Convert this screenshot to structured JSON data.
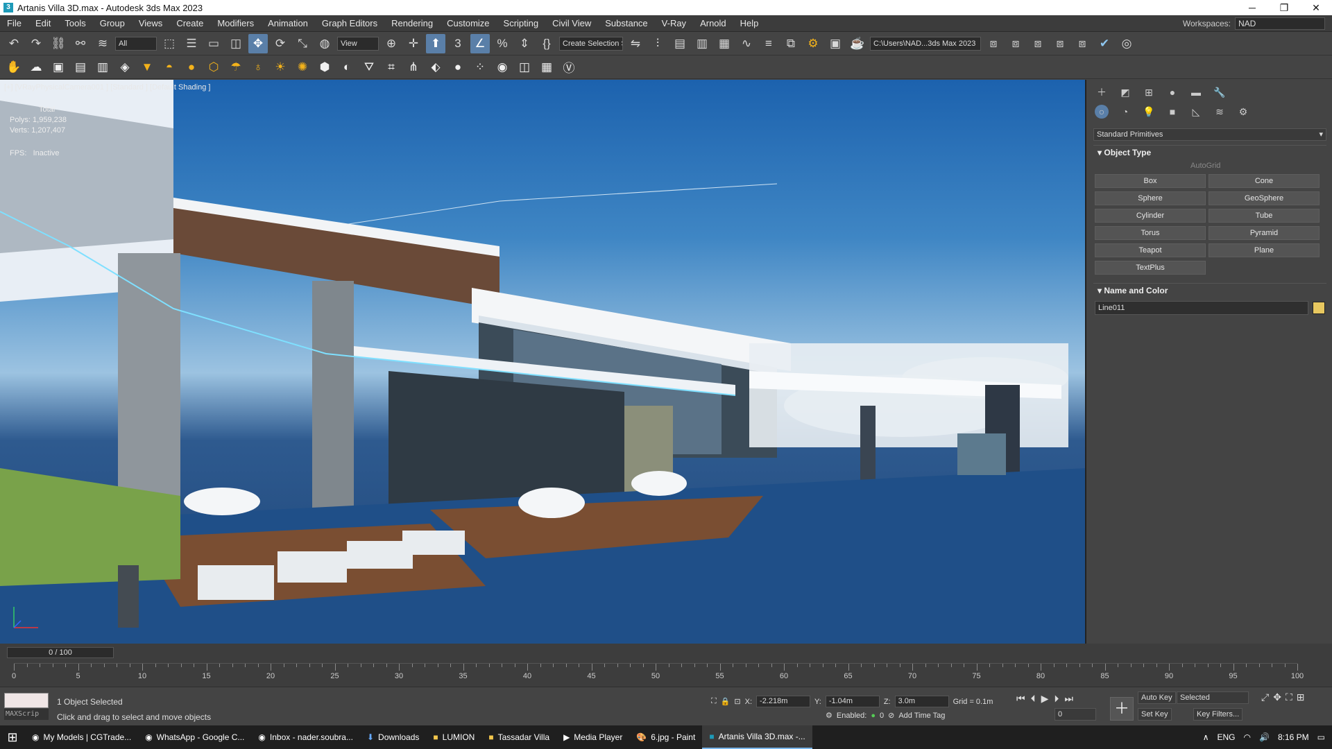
{
  "window": {
    "title": "Artanis Villa 3D.max - Autodesk 3ds Max 2023"
  },
  "menu": [
    "File",
    "Edit",
    "Tools",
    "Group",
    "Views",
    "Create",
    "Modifiers",
    "Animation",
    "Graph Editors",
    "Rendering",
    "Customize",
    "Scripting",
    "Civil View",
    "Substance",
    "V-Ray",
    "Arnold",
    "Help"
  ],
  "workspace": {
    "label": "Workspaces:",
    "value": "NAD"
  },
  "toolbar": {
    "filter": "All",
    "ref_coord": "View",
    "selection_set": "Create Selection Se",
    "project_path": "C:\\Users\\NAD...3ds Max 2023"
  },
  "viewport": {
    "label": "[+] [VRayPhysicalCamera001 ] [Standard ] [Default Shading ]",
    "stats_header": "Total",
    "polys_label": "Polys:",
    "polys": "1,959,238",
    "verts_label": "Verts:",
    "verts": "1,207,407",
    "fps_label": "FPS:",
    "fps": "Inactive"
  },
  "command_panel": {
    "category": "Standard Primitives",
    "object_type_title": "Object Type",
    "autogrid": "AutoGrid",
    "buttons": [
      "Box",
      "Cone",
      "Sphere",
      "GeoSphere",
      "Cylinder",
      "Tube",
      "Torus",
      "Pyramid",
      "Teapot",
      "Plane",
      "TextPlus"
    ],
    "name_color_title": "Name and Color",
    "object_name": "Line011",
    "object_color": "#e8c860"
  },
  "timeline": {
    "frame": "0 / 100",
    "labels": [
      "0",
      "5",
      "10",
      "15",
      "20",
      "25",
      "30",
      "35",
      "40",
      "45",
      "50",
      "55",
      "60",
      "65",
      "70",
      "75",
      "80",
      "85",
      "90",
      "95",
      "100"
    ]
  },
  "status": {
    "selected": "1 Object Selected",
    "prompt": "Click and drag to select and move objects",
    "maxscript": "MAXScrip",
    "x_label": "X:",
    "x": "-2.218m",
    "y_label": "Y:",
    "y": "-1.04m",
    "z_label": "Z:",
    "z": "3.0m",
    "grid": "Grid = 0.1m",
    "enabled": "Enabled:",
    "enabled_value": "0",
    "add_time_tag": "Add Time Tag",
    "auto_key": "Auto Key",
    "set_key": "Set Key",
    "selected_dd": "Selected",
    "key_filters": "Key Filters...",
    "frame_field": "0"
  },
  "taskbar": {
    "items": [
      "My Models | CGTrade...",
      "WhatsApp - Google C...",
      "Inbox - nader.soubra...",
      "Downloads",
      "LUMION",
      "Tassadar Villa",
      "Media Player",
      "6.jpg - Paint",
      "Artanis Villa 3D.max -..."
    ],
    "lang": "ENG",
    "time": "8:16 PM"
  }
}
